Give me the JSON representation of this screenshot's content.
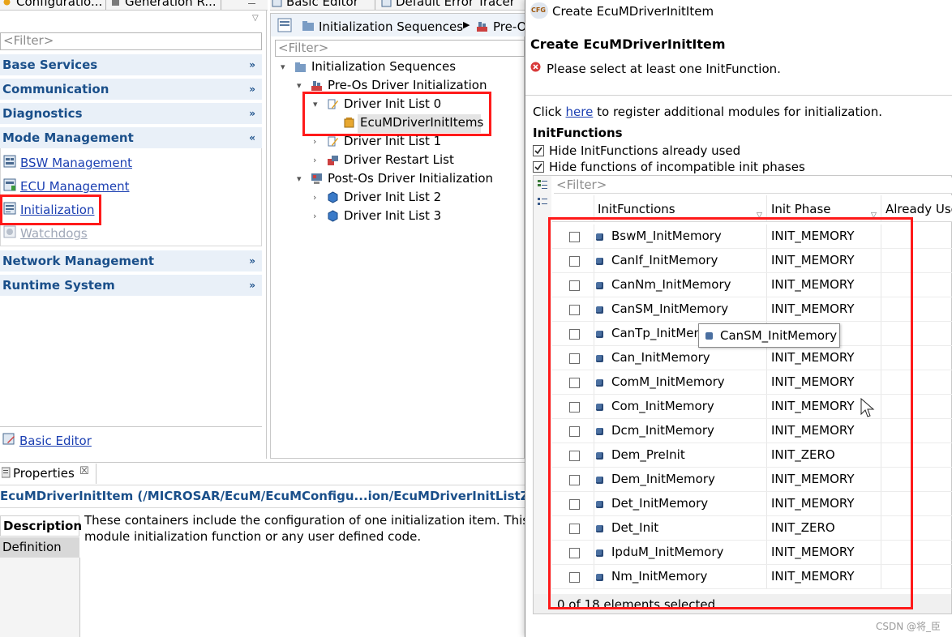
{
  "left_tabs": {
    "config": "Configuratio...",
    "generation": "Generation R..."
  },
  "left_filter_placeholder": "<Filter>",
  "sections": [
    {
      "label": "Base Services"
    },
    {
      "label": "Communication"
    },
    {
      "label": "Diagnostics"
    },
    {
      "label": "Mode Management"
    },
    {
      "label": "Network Management"
    },
    {
      "label": "Runtime System"
    }
  ],
  "mode_links": [
    "BSW Management",
    "ECU Management",
    "Initialization",
    "Watchdogs"
  ],
  "basic_editor_link": "Basic Editor",
  "center_tabs": {
    "basic": "Basic Editor",
    "error": "Default Error Tracer"
  },
  "breadcrumb": {
    "item1": "Initialization Sequences",
    "item2": "Pre-O"
  },
  "center_filter_placeholder": "<Filter>",
  "tree": {
    "root": "Initialization Sequences",
    "preos": "Pre-Os Driver Initialization",
    "list0": "Driver Init List 0",
    "items": "EcuMDriverInitItems",
    "list1": "Driver Init List 1",
    "restart": "Driver Restart List",
    "postos": "Post-Os Driver Initialization",
    "list2": "Driver Init List 2",
    "list3": "Driver Init List 3"
  },
  "properties": {
    "tab": "Properties",
    "path": "EcuMDriverInitItem (/MICROSAR/EcuM/EcuMConfigu...ion/EcuMDriverInitListZero/Ec",
    "desc_tab": "Description",
    "def_tab": "Definition",
    "desc_line1": "These containers include the configuration of one initialization item. This m",
    "desc_line2": "module initialization function or any user defined code."
  },
  "dialog": {
    "window_title": "Create EcuMDriverInitItem",
    "heading": "Create EcuMDriverInitItem",
    "error": "Please select at least one InitFunction.",
    "click": "Click",
    "here": "here",
    "register_rest": "to register additional modules for initialization.",
    "section_label": "InitFunctions",
    "hide_used": "Hide InitFunctions already used",
    "hide_incompat": "Hide functions of incompatible init phases",
    "filter_placeholder": "<Filter>",
    "col_fn": "InitFunctions",
    "col_phase": "Init Phase",
    "col_used": "Already Use",
    "status": "0 of 18 elements selected",
    "tooltip": "CanSM_InitMemory",
    "watermark": "CSDN @将_臣",
    "cfg_icon": "CFG"
  },
  "rows": [
    {
      "fn": "BswM_InitMemory",
      "phase": "INIT_MEMORY"
    },
    {
      "fn": "CanIf_InitMemory",
      "phase": "INIT_MEMORY"
    },
    {
      "fn": "CanNm_InitMemory",
      "phase": "INIT_MEMORY"
    },
    {
      "fn": "CanSM_InitMemory",
      "phase": "INIT_MEMORY"
    },
    {
      "fn": "CanTp_InitMem",
      "phase": "RY"
    },
    {
      "fn": "Can_InitMemory",
      "phase": "INIT_MEMORY"
    },
    {
      "fn": "ComM_InitMemory",
      "phase": "INIT_MEMORY"
    },
    {
      "fn": "Com_InitMemory",
      "phase": "INIT_MEMORY"
    },
    {
      "fn": "Dcm_InitMemory",
      "phase": "INIT_MEMORY"
    },
    {
      "fn": "Dem_PreInit",
      "phase": "INIT_ZERO"
    },
    {
      "fn": "Dem_InitMemory",
      "phase": "INIT_MEMORY"
    },
    {
      "fn": "Det_InitMemory",
      "phase": "INIT_MEMORY"
    },
    {
      "fn": "Det_Init",
      "phase": "INIT_ZERO"
    },
    {
      "fn": "IpduM_InitMemory",
      "phase": "INIT_MEMORY"
    },
    {
      "fn": "Nm_InitMemory",
      "phase": "INIT_MEMORY"
    }
  ]
}
